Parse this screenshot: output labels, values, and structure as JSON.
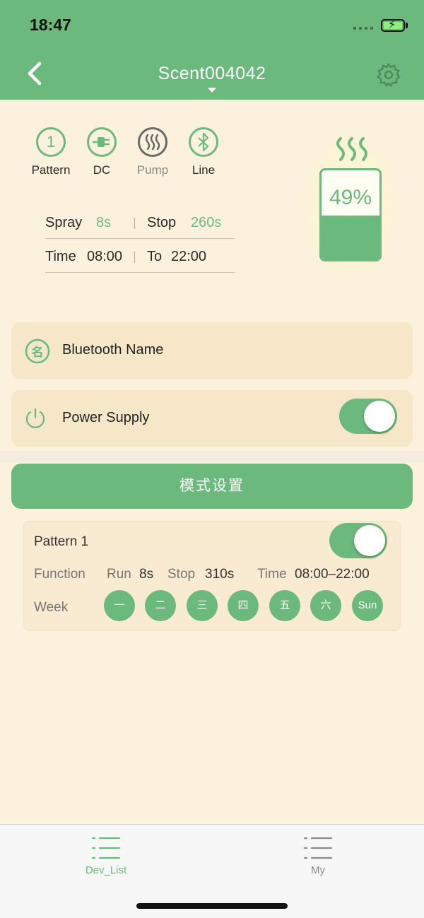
{
  "status_bar": {
    "time": "18:47"
  },
  "header": {
    "title": "Scent004042"
  },
  "modes": [
    {
      "label": "Pattern",
      "icon": "pattern-1-icon",
      "glyph": "1"
    },
    {
      "label": "DC",
      "icon": "dc-plug-icon"
    },
    {
      "label": "Pump",
      "icon": "pump-heat-icon"
    },
    {
      "label": "Line",
      "icon": "bluetooth-icon"
    }
  ],
  "settings": {
    "spray_label": "Spray",
    "spray_value": "8s",
    "stop_label": "Stop",
    "stop_value": "260s",
    "time_label": "Time",
    "time_value": "08:00",
    "to_label": "To",
    "to_value": "22:00"
  },
  "bottle": {
    "level_text": "49%",
    "level": 0.49
  },
  "bluetooth_name": {
    "label": "Bluetooth Name",
    "icon_glyph": "名"
  },
  "power_supply": {
    "label": "Power Supply",
    "on": true
  },
  "mode_settings_button": "模式设置",
  "pattern_card": {
    "title": "Pattern  1",
    "enabled": true,
    "function_label": "Function",
    "run_label": "Run",
    "run_value": "8s",
    "stop_label": "Stop",
    "stop_value": "310s",
    "time_label": "Time",
    "time_value": "08:00–22:00",
    "week_label": "Week",
    "days": [
      "一",
      "二",
      "三",
      "四",
      "五",
      "六",
      "Sun"
    ]
  },
  "tabbar": {
    "tabs": [
      {
        "label": "Dev_List",
        "active": true
      },
      {
        "label": "My",
        "active": false
      }
    ]
  },
  "colors": {
    "accent": "#6bb97d",
    "background": "#fbf1dc",
    "card": "#f6e7c9"
  }
}
